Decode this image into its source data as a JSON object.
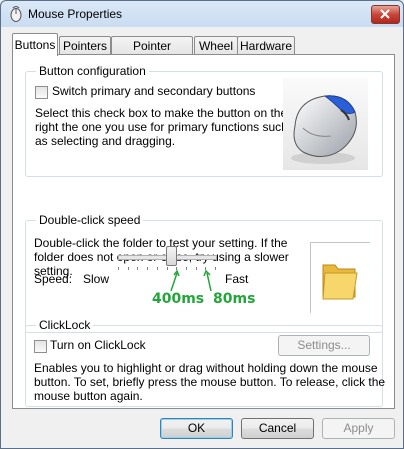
{
  "window": {
    "title": "Mouse Properties"
  },
  "tabs": [
    {
      "label": "Buttons"
    },
    {
      "label": "Pointers"
    },
    {
      "label": "Pointer Options"
    },
    {
      "label": "Wheel"
    },
    {
      "label": "Hardware"
    }
  ],
  "button_config": {
    "title": "Button configuration",
    "switch_label": "Switch primary and secondary buttons",
    "switch_checked": false,
    "description": [
      "Select this check box to make the button on the",
      "right the one you use for primary functions such",
      "as selecting and dragging."
    ]
  },
  "double_click": {
    "title": "Double-click speed",
    "description": [
      "Double-click the folder to test your setting. If the",
      "folder does not open or close, try using a slower",
      "setting."
    ],
    "speed_label": "Speed:",
    "slow_label": "Slow",
    "fast_label": "Fast",
    "slider_value": 0.55
  },
  "annotations": {
    "left": "400ms",
    "right": "80ms",
    "color": "#22a63a"
  },
  "clicklock": {
    "title": "ClickLock",
    "turn_on_label": "Turn on ClickLock",
    "turn_on_checked": false,
    "settings_label": "Settings...",
    "description": [
      "Enables you to highlight or drag without holding down the mouse",
      "button. To set, briefly press the mouse button. To release, click the",
      "mouse button again."
    ]
  },
  "footer": {
    "ok": "OK",
    "cancel": "Cancel",
    "apply": "Apply"
  }
}
